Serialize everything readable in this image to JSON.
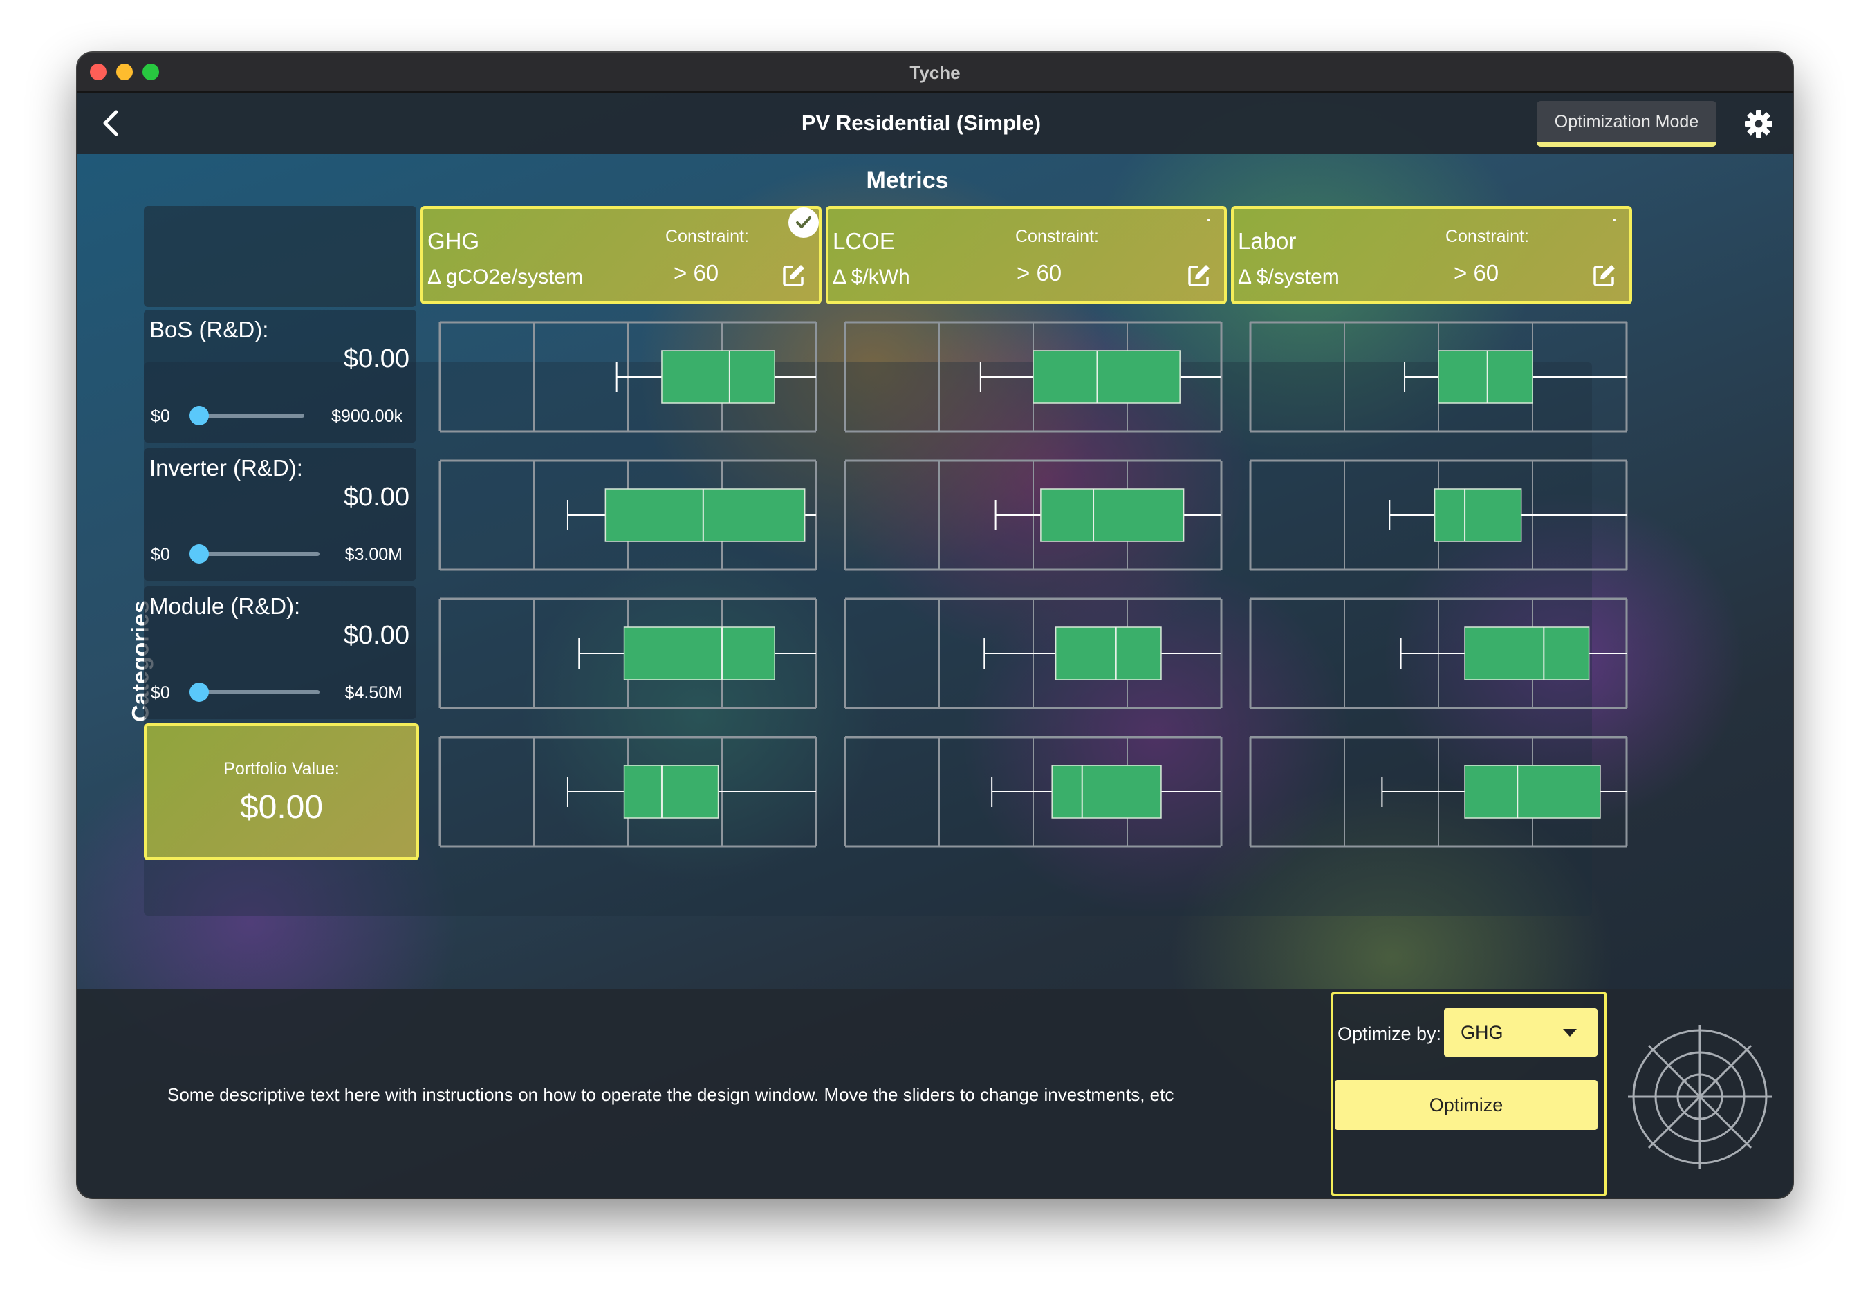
{
  "window": {
    "title": "Tyche"
  },
  "navbar": {
    "title": "PV Residential (Simple)",
    "mode_button": "Optimization Mode"
  },
  "metrics_title": "Metrics",
  "categories_label": "Categories",
  "metrics": [
    {
      "name": "GHG",
      "unit": "Δ gCO2e/system",
      "constraint_label": "Constraint:",
      "constraint_value": "> 60",
      "selected": true
    },
    {
      "name": "LCOE",
      "unit": "Δ $/kWh",
      "constraint_label": "Constraint:",
      "constraint_value": "> 60",
      "selected": false
    },
    {
      "name": "Labor",
      "unit": "Δ $/system",
      "constraint_label": "Constraint:",
      "constraint_value": "> 60",
      "selected": false
    }
  ],
  "categories": [
    {
      "name": "BoS (R&D):",
      "value": "$0.00",
      "slider_min": "$0",
      "slider_max": "$900.00k",
      "slider_fraction": 0
    },
    {
      "name": "Inverter (R&D):",
      "value": "$0.00",
      "slider_min": "$0",
      "slider_max": "$3.00M",
      "slider_fraction": 0
    },
    {
      "name": "Module (R&D):",
      "value": "$0.00",
      "slider_min": "$0",
      "slider_max": "$4.50M",
      "slider_fraction": 0
    }
  ],
  "portfolio": {
    "label": "Portfolio Value:",
    "value": "$0.00"
  },
  "boxplots": [
    [
      {
        "wl": 0.47,
        "q1": 0.59,
        "med": 0.77,
        "q3": 0.89,
        "wh": 1.0
      },
      {
        "wl": 0.36,
        "q1": 0.5,
        "med": 0.67,
        "q3": 0.89,
        "wh": 1.0
      },
      {
        "wl": 0.41,
        "q1": 0.5,
        "med": 0.63,
        "q3": 0.75,
        "wh": 1.0
      }
    ],
    [
      {
        "wl": 0.34,
        "q1": 0.44,
        "med": 0.7,
        "q3": 0.97,
        "wh": 1.0
      },
      {
        "wl": 0.4,
        "q1": 0.52,
        "med": 0.66,
        "q3": 0.9,
        "wh": 1.0
      },
      {
        "wl": 0.37,
        "q1": 0.49,
        "med": 0.57,
        "q3": 0.72,
        "wh": 1.0
      }
    ],
    [
      {
        "wl": 0.37,
        "q1": 0.49,
        "med": 0.75,
        "q3": 0.89,
        "wh": 1.0
      },
      {
        "wl": 0.37,
        "q1": 0.56,
        "med": 0.72,
        "q3": 0.84,
        "wh": 1.0
      },
      {
        "wl": 0.4,
        "q1": 0.57,
        "med": 0.78,
        "q3": 0.9,
        "wh": 1.0
      }
    ],
    [
      {
        "wl": 0.34,
        "q1": 0.49,
        "med": 0.59,
        "q3": 0.74,
        "wh": 1.0
      },
      {
        "wl": 0.39,
        "q1": 0.55,
        "med": 0.63,
        "q3": 0.84,
        "wh": 1.0
      },
      {
        "wl": 0.35,
        "q1": 0.57,
        "med": 0.71,
        "q3": 0.93,
        "wh": 1.0
      }
    ]
  ],
  "colors": {
    "accent": "#f5ee5a",
    "box_fill": "#3aaf6a",
    "slider_thumb": "#5ac8fa"
  },
  "bottom": {
    "description": "Some descriptive text here with instructions on how to operate the design window. Move the sliders to change investments, etc",
    "optimize_by_label": "Optimize by:",
    "optimize_by_value": "GHG",
    "optimize_button": "Optimize"
  },
  "icons": {
    "back": "chevron-left-icon",
    "settings": "gear-icon",
    "edit": "edit-icon",
    "check": "check-icon",
    "radar": "radar-icon"
  }
}
